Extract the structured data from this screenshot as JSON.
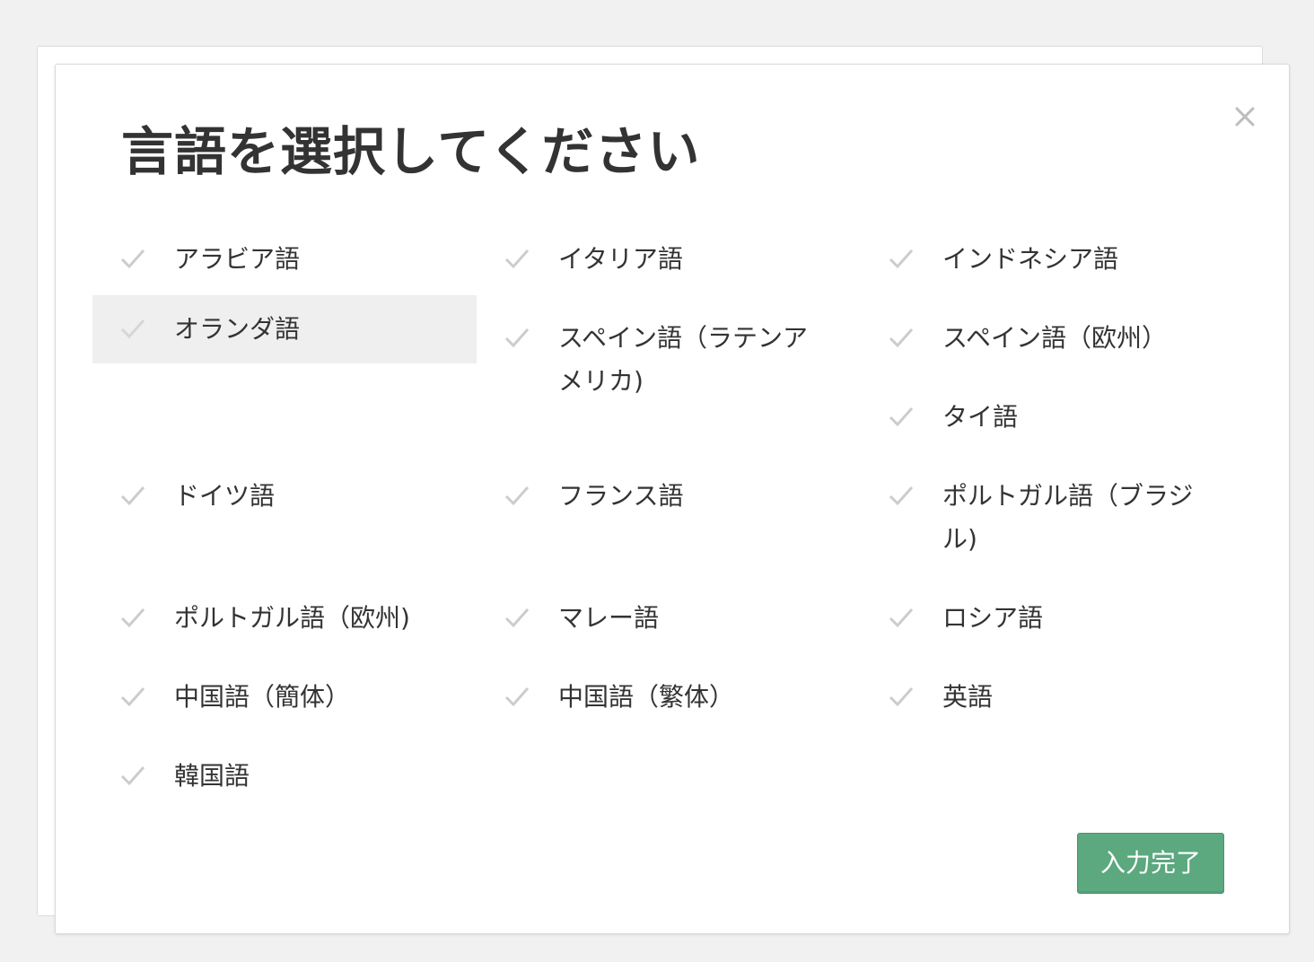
{
  "dialog": {
    "title": "言語を選択してください",
    "close_icon": "close-icon",
    "done_label": "入力完了",
    "colors": {
      "done_button": "#5ca87f",
      "selected_row": "#efefef",
      "check_mark": "#cccccc"
    }
  },
  "languages": [
    {
      "label": "アラビア語",
      "selected": false
    },
    {
      "label": "イタリア語",
      "selected": false
    },
    {
      "label": "インドネシア語",
      "selected": false
    },
    {
      "label": "オランダ語",
      "selected": true
    },
    {
      "label": "スペイン語（ラテンアメリカ)",
      "selected": false
    },
    {
      "label": "スペイン語（欧州）",
      "selected": false
    },
    {
      "label": "タイ語",
      "selected": false
    },
    {
      "label": "ドイツ語",
      "selected": false
    },
    {
      "label": "フランス語",
      "selected": false
    },
    {
      "label": "ポルトガル語（ブラジル)",
      "selected": false
    },
    {
      "label": "ポルトガル語（欧州)",
      "selected": false
    },
    {
      "label": "マレー語",
      "selected": false
    },
    {
      "label": "ロシア語",
      "selected": false
    },
    {
      "label": "中国語（簡体）",
      "selected": false
    },
    {
      "label": "中国語（繁体）",
      "selected": false
    },
    {
      "label": "英語",
      "selected": false
    },
    {
      "label": "韓国語",
      "selected": false
    }
  ]
}
